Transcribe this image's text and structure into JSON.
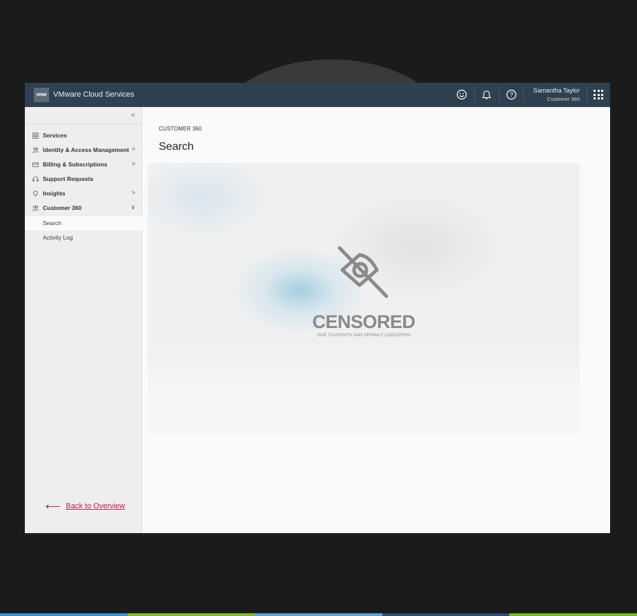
{
  "header": {
    "logo_text": "vmw",
    "app_title": "VMware Cloud Services",
    "user_name": "Samantha Taylor",
    "user_org": "Customer 360",
    "icons": [
      "feedback-smiley-icon",
      "bell-icon",
      "help-icon",
      "app-grid-icon"
    ]
  },
  "sidebar": {
    "collapse_glyph": "«",
    "items": [
      {
        "label": "Services",
        "icon": "grid-icon",
        "chevron": ""
      },
      {
        "label": "Identity & Access Management",
        "icon": "users-icon",
        "chevron": ">"
      },
      {
        "label": "Billing & Subscriptions",
        "icon": "card-icon",
        "chevron": ">"
      },
      {
        "label": "Support Requests",
        "icon": "headset-icon",
        "chevron": ""
      },
      {
        "label": "Insights",
        "icon": "bulb-icon",
        "chevron": ">"
      },
      {
        "label": "Customer 360",
        "icon": "users-icon",
        "chevron": "∨"
      }
    ],
    "sub_items": [
      {
        "label": "Search",
        "active": true
      },
      {
        "label": "Activity Log",
        "active": false
      }
    ],
    "back_link": {
      "arrow": "⟵",
      "label": "Back to Overview"
    }
  },
  "main": {
    "breadcrumb": "CUSTOMER 360",
    "title": "Search",
    "censored": {
      "title": "CENSORED",
      "subtitle": "DUE TO RIGHTS AND PRIVACY CONCERNS",
      "icon": "eye-off-icon"
    }
  },
  "colors": {
    "header_bg": "#2f4150",
    "accent_link": "#b5214e",
    "page_bg": "#1b1b1b"
  }
}
